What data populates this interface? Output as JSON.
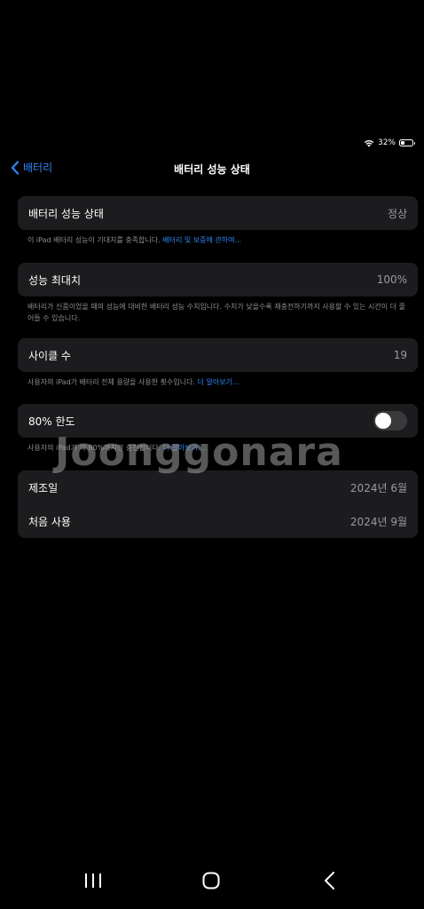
{
  "status": {
    "battery_percent_text": "32%",
    "battery_level": 0.32
  },
  "nav": {
    "back_label": "배터리",
    "title": "배터리 성능 상태"
  },
  "health": {
    "label": "배터리 성능 상태",
    "value": "정상"
  },
  "health_note": {
    "text": "이 iPad 배터리 성능이 기대치를 충족합니다. ",
    "link": "배터리 및 보증에 관하여..."
  },
  "capacity": {
    "label": "성능 최대치",
    "value": "100%"
  },
  "capacity_note": {
    "text": "배터리가 신품이었을 때의 성능에 대비한 배터리 성능 수치입니다. 수치가 낮을수록 재충전하기까지 사용할 수 있는 시간이 더 줄어들 수 있습니다."
  },
  "cycles": {
    "label": "사이클 수",
    "value": "19"
  },
  "cycles_note": {
    "text": "사용자의 iPad가 배터리 전체 용량을 사용한 횟수입니다. ",
    "link": "더 알아보기..."
  },
  "limit": {
    "label": "80% 한도",
    "enabled": false
  },
  "limit_note": {
    "text": "사용자의 iPad가 약 80%까지만 충전합니다. ",
    "link": "더 알아보기..."
  },
  "dates": {
    "manufacture_label": "제조일",
    "manufacture_value": "2024년 6월",
    "first_use_label": "처음 사용",
    "first_use_value": "2024년 9월"
  },
  "watermark": "Joonggonara",
  "colors": {
    "accent": "#2f86f6",
    "background": "#000000",
    "card": "#1c1c1e",
    "secondary_text": "#8e8e93"
  },
  "icons": {
    "wifi": "wifi-icon",
    "battery": "battery-icon",
    "back": "chevron-left-icon",
    "recents": "recents-icon",
    "home": "home-icon",
    "android_back": "android-back-icon"
  }
}
